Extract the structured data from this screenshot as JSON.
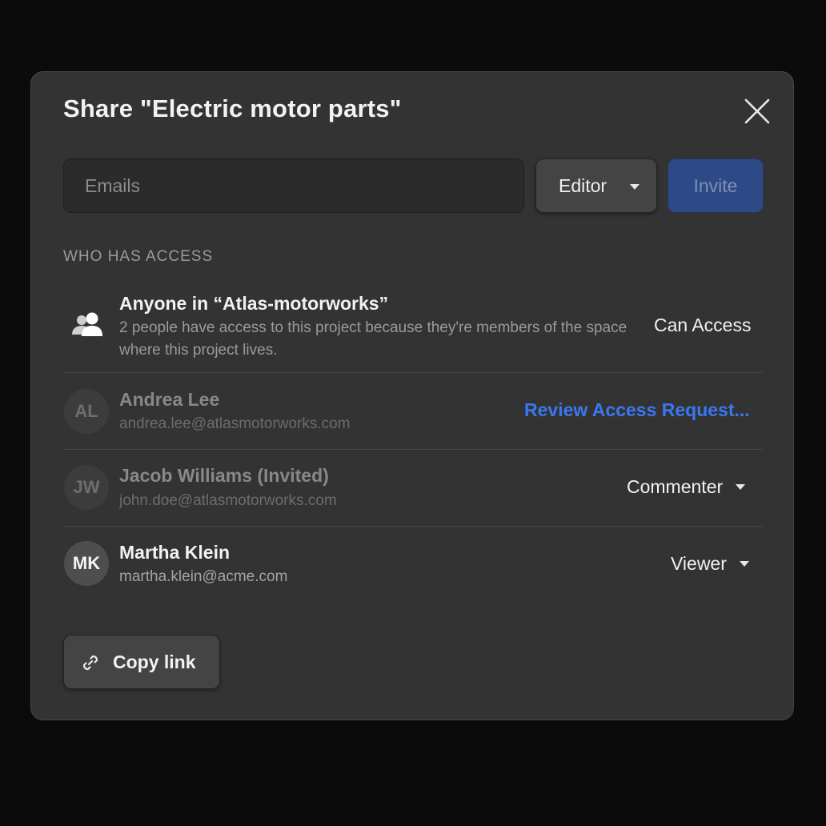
{
  "dialog": {
    "title": "Share \"Electric motor parts\"",
    "close_icon": "close-icon"
  },
  "invite": {
    "email_placeholder": "Emails",
    "email_value": "",
    "role_label": "Editor",
    "role_icon": "chevron-down-icon",
    "invite_label": "Invite"
  },
  "access": {
    "section_label": "WHO HAS ACCESS",
    "group": {
      "icon": "people-icon",
      "title": "Anyone in “Atlas-motorworks”",
      "description": "2 people have access to this project because they're members of the space where this project lives.",
      "permission": "Can Access"
    },
    "people": [
      {
        "initials": "AL",
        "name": "Andrea Lee",
        "email": "andrea.lee@atlasmotorworks.com",
        "action": "Review Access Request..."
      },
      {
        "initials": "JW",
        "name": "Jacob Williams (Invited)",
        "email": "john.doe@atlasmotorworks.com",
        "role": "Commenter"
      },
      {
        "initials": "MK",
        "name": "Martha Klein",
        "email": "martha.klein@acme.com",
        "role": "Viewer"
      }
    ]
  },
  "footer": {
    "copy_link_label": "Copy link",
    "copy_link_icon": "link-icon"
  },
  "colors": {
    "background": "#0b0b0b",
    "dialog": "#333333",
    "accent_link": "#3a78f2",
    "invite_button": "#2e4a86"
  }
}
